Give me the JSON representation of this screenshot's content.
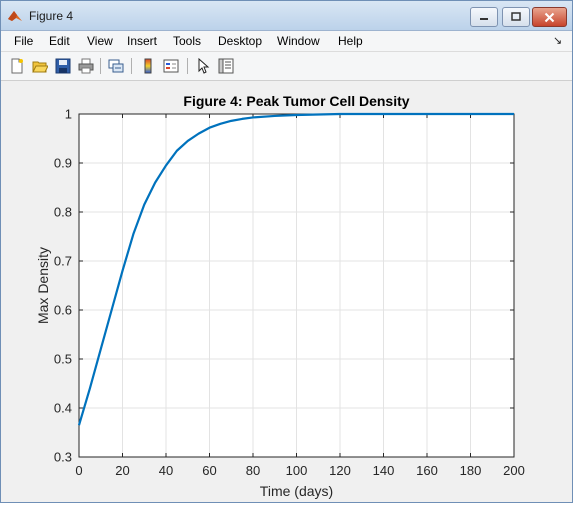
{
  "window": {
    "title": "Figure 4"
  },
  "menu": {
    "items": [
      "File",
      "Edit",
      "View",
      "Insert",
      "Tools",
      "Desktop",
      "Window",
      "Help"
    ]
  },
  "toolbar": {
    "icons": [
      "new-figure-icon",
      "open-file-icon",
      "save-icon",
      "print-icon",
      "link-plot-icon",
      "insert-colorbar-icon",
      "insert-legend-icon",
      "edit-plot-icon",
      "property-inspector-icon"
    ]
  },
  "chart_data": {
    "type": "line",
    "title": "Figure 4: Peak Tumor Cell Density",
    "xlabel": "Time (days)",
    "ylabel": "Max Density",
    "xlim": [
      0,
      200
    ],
    "ylim": [
      0.3,
      1.0
    ],
    "xticks": [
      "0",
      "20",
      "40",
      "60",
      "80",
      "100",
      "120",
      "140",
      "160",
      "180",
      "200"
    ],
    "yticks": [
      "0.3",
      "0.4",
      "0.5",
      "0.6",
      "0.7",
      "0.8",
      "0.9",
      "1"
    ],
    "grid": true,
    "line_color": "#0072bd",
    "series": [
      {
        "x": [
          0,
          5,
          10,
          15,
          20,
          25,
          30,
          35,
          40,
          45,
          50,
          55,
          60,
          65,
          70,
          75,
          80,
          90,
          100,
          110,
          120,
          140,
          160,
          180,
          200
        ],
        "y": [
          0.365,
          0.44,
          0.52,
          0.6,
          0.68,
          0.755,
          0.815,
          0.86,
          0.895,
          0.925,
          0.945,
          0.96,
          0.972,
          0.98,
          0.986,
          0.99,
          0.993,
          0.996,
          0.998,
          0.999,
          1.0,
          1.0,
          1.0,
          1.0,
          1.0
        ]
      }
    ]
  }
}
